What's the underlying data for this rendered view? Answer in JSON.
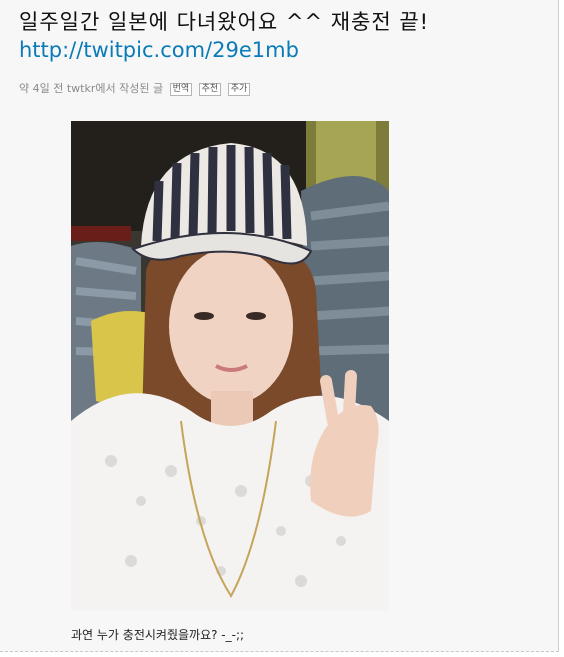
{
  "post": {
    "title_text": "일주일간 일본에 다녀왔어요 ^^ 재충전 끝!",
    "link_text": "http://twitpic.com/29e1mb"
  },
  "meta": {
    "info": "약 4일 전 twtkr에서 작성된 글",
    "buttons": [
      "번역",
      "추천",
      "추가"
    ]
  },
  "caption": "과연 누가 충전시켜줬을까요? -_-;;"
}
